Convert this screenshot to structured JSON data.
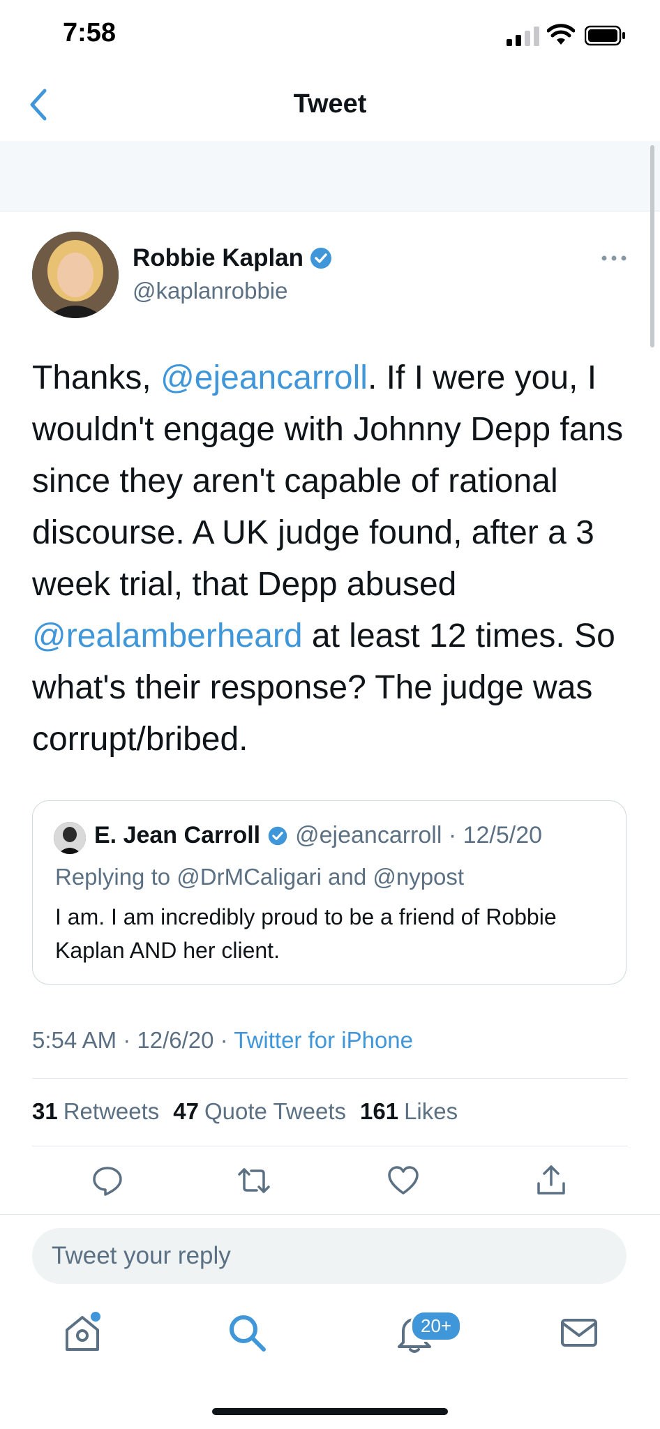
{
  "status_bar": {
    "time": "7:58"
  },
  "nav": {
    "title": "Tweet"
  },
  "tweet": {
    "author_name": "Robbie Kaplan",
    "author_handle": "@kaplanrobbie",
    "text_segments": [
      "Thanks, ",
      "@ejeancarroll",
      ". If I were you, I wouldn't engage with Johnny Depp fans since they aren't capable of rational discourse. A UK judge found, after a 3 week trial, that Depp abused ",
      "@realamberheard",
      " at least 12 times. So what's their response?  The judge was corrupt/bribed."
    ],
    "timestamp": "5:54 AM · 12/6/20 · ",
    "source": "Twitter for iPhone"
  },
  "quote": {
    "name": "E. Jean Carroll",
    "handle_date": "@ejeancarroll · 12/5/20",
    "replying": "Replying to @DrMCaligari and @nypost",
    "text": "I am. I am incredibly proud to be a friend of Robbie Kaplan AND her client."
  },
  "stats": {
    "retweets_count": "31",
    "retweets_label": "Retweets",
    "quotes_count": "47",
    "quotes_label": "Quote Tweets",
    "likes_count": "161",
    "likes_label": "Likes"
  },
  "reply": {
    "placeholder": "Tweet your reply"
  },
  "tabs": {
    "notifications_badge": "20+"
  },
  "colors": {
    "accent": "#3f96d9",
    "secondary_text": "#5b7083",
    "text": "#0f1419"
  }
}
